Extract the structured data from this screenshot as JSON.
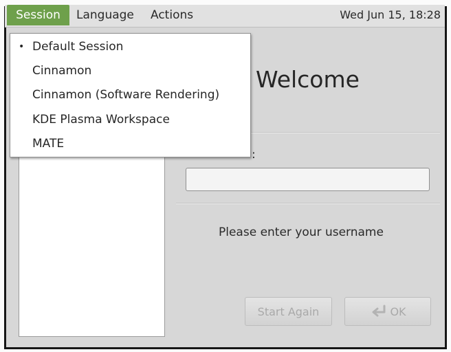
{
  "menubar": {
    "session": "Session",
    "language": "Language",
    "actions": "Actions",
    "clock": "Wed Jun 15, 18:28"
  },
  "session_menu": {
    "items": [
      {
        "label": "Default Session",
        "selected": true
      },
      {
        "label": "Cinnamon",
        "selected": false
      },
      {
        "label": "Cinnamon (Software Rendering)",
        "selected": false
      },
      {
        "label": "KDE Plasma Workspace",
        "selected": false
      },
      {
        "label": "MATE",
        "selected": false
      }
    ],
    "bullet": "•"
  },
  "greeter": {
    "title": "Welcome",
    "prompt_label": ":",
    "username_value": "",
    "message": "Please enter your username"
  },
  "buttons": {
    "start_again": "Start Again",
    "ok": "OK"
  },
  "icons": {
    "ok_icon": "enter-arrow-icon"
  },
  "colors": {
    "menu_active_bg": "#6ea04b",
    "background": "#d7d7d7",
    "disabled_text": "#a9a9a9"
  }
}
